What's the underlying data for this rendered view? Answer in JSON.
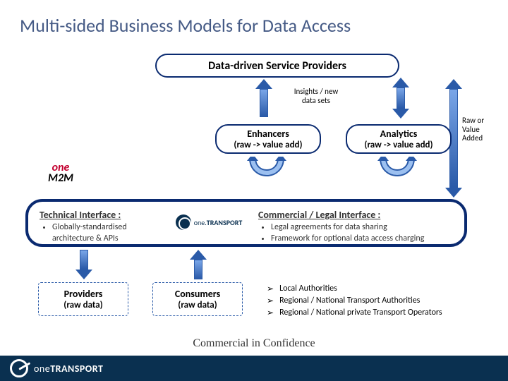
{
  "title": "Multi-sided Business Models for Data Access",
  "top_box": "Data-driven Service Providers",
  "insights_label": {
    "line1": "Insights / new",
    "line2": "data sets"
  },
  "raw_value_label": {
    "line1": "Raw or",
    "line2": "Value",
    "line3": "Added"
  },
  "enhancers": {
    "title": "Enhancers",
    "sub": "(raw -> value add)"
  },
  "analytics": {
    "title": "Analytics",
    "sub": "(raw -> value add)"
  },
  "panel": {
    "tech_heading": "Technical Interface :",
    "tech_items": [
      "Globally-standardised architecture & APIs"
    ],
    "com_heading": "Commercial / Legal Interface :",
    "com_items": [
      "Legal agreements for data sharing",
      "Framework for optional data access charging"
    ]
  },
  "providers": {
    "title": "Providers",
    "sub": "(raw data)"
  },
  "consumers": {
    "title": "Consumers",
    "sub": "(raw data)"
  },
  "stakeholders": [
    "Local Authorities",
    "Regional / National Transport Authorities",
    "Regional / National private Transport Operators"
  ],
  "confidential": "Commercial in Confidence",
  "brand": {
    "one": "one",
    "m2m": "M2M",
    "transport": "TRANSPORT"
  },
  "marks": {
    "bullet": "•",
    "chevron": "➢"
  }
}
